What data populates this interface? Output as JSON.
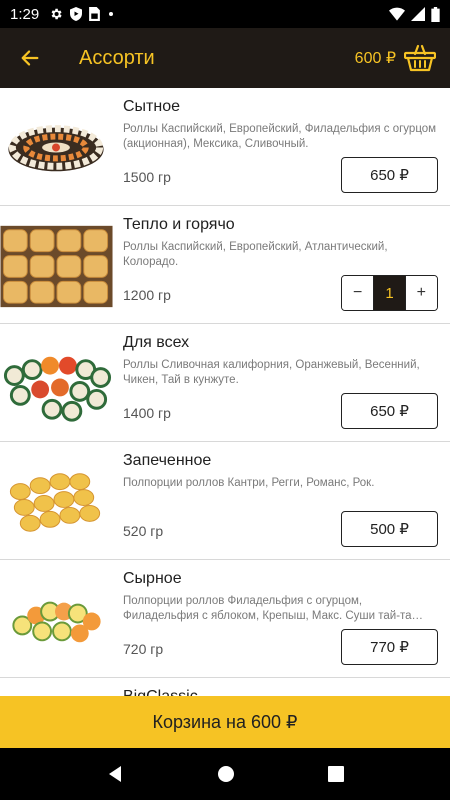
{
  "status_bar": {
    "time": "1:29",
    "icons": [
      "gear-icon",
      "shield-icon",
      "sim-card-icon",
      "dot-icon",
      "wifi-icon",
      "signal-icon",
      "battery-icon"
    ]
  },
  "header": {
    "title": "Ассорти",
    "cart_total": "600 ₽",
    "colors": {
      "background": "#1f1a16",
      "accent": "#f6c324"
    }
  },
  "products": [
    {
      "name": "Сытное",
      "description": "Роллы Каспийский, Европейский, Филадельфия с огурцом (акционная), Мексика, Сливочный.",
      "weight": "1500 гр",
      "price": "650 ₽",
      "in_cart": false
    },
    {
      "name": "Тепло и горячо",
      "description": "Роллы Каспийский, Европейский, Атлантический, Колорадо.",
      "weight": "1200 гр",
      "in_cart": true,
      "quantity": "1",
      "minus": "−",
      "plus": "+"
    },
    {
      "name": "Для всех",
      "description": "Роллы Сливочная калифорния, Оранжевый, Весенний, Чикен, Тай в кунжуте.",
      "weight": "1400 гр",
      "price": "650 ₽",
      "in_cart": false
    },
    {
      "name": "Запеченное",
      "description": "Полпорции роллов Кантри, Регги, Романс, Рок.",
      "weight": "520 гр",
      "price": "500 ₽",
      "in_cart": false
    },
    {
      "name": "Сырное",
      "description": "Полпорции роллов Филадельфия с огурцом, Филадельфия с яблоком, Крепыш, Макс. Суши тай-та…",
      "weight": "720 гр",
      "price": "770 ₽",
      "in_cart": false
    },
    {
      "name": "BigClassic"
    }
  ],
  "cart_button": {
    "label": "Корзина на 600 ₽"
  },
  "nav_bar": {
    "icons": [
      "back-triangle-icon",
      "home-circle-icon",
      "recents-square-icon"
    ]
  }
}
